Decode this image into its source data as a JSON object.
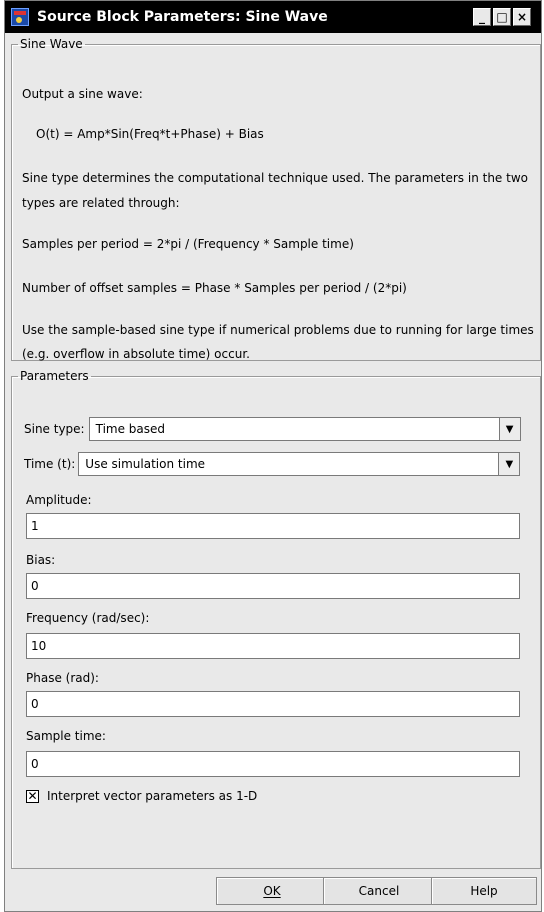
{
  "window": {
    "title": "Source Block Parameters: Sine Wave",
    "controls": {
      "minimize": "_",
      "maximize": "□",
      "close": "×"
    }
  },
  "description_group": {
    "legend": "Sine Wave",
    "lines": [
      "Output a sine wave:",
      "O(t) = Amp*Sin(Freq*t+Phase) + Bias",
      "Sine type determines the computational technique used. The parameters in the two",
      "types are related through:",
      "Samples per period = 2*pi / (Frequency * Sample time)",
      "Number of offset samples = Phase * Samples per period / (2*pi)",
      "Use the sample-based sine type if numerical problems due to running for large times",
      "(e.g. overflow in absolute time) occur."
    ]
  },
  "parameters_group": {
    "legend": "Parameters",
    "sine_type": {
      "label": "Sine type:",
      "value": "Time based"
    },
    "time": {
      "label": "Time (t):",
      "value": "Use simulation time"
    },
    "amplitude": {
      "label": "Amplitude:",
      "value": "1"
    },
    "bias": {
      "label": "Bias:",
      "value": "0"
    },
    "frequency": {
      "label": "Frequency (rad/sec):",
      "value": "10"
    },
    "phase": {
      "label": "Phase (rad):",
      "value": "0"
    },
    "sample_time": {
      "label": "Sample time:",
      "value": "0"
    },
    "interpret_vector": {
      "label": "Interpret vector parameters as 1-D",
      "checked": true
    }
  },
  "buttons": {
    "ok": "OK",
    "cancel": "Cancel",
    "help": "Help"
  },
  "icons": {
    "dropdown": "chevron-down-icon",
    "check": "check-mark-icon",
    "app": "simulink-block-icon"
  }
}
